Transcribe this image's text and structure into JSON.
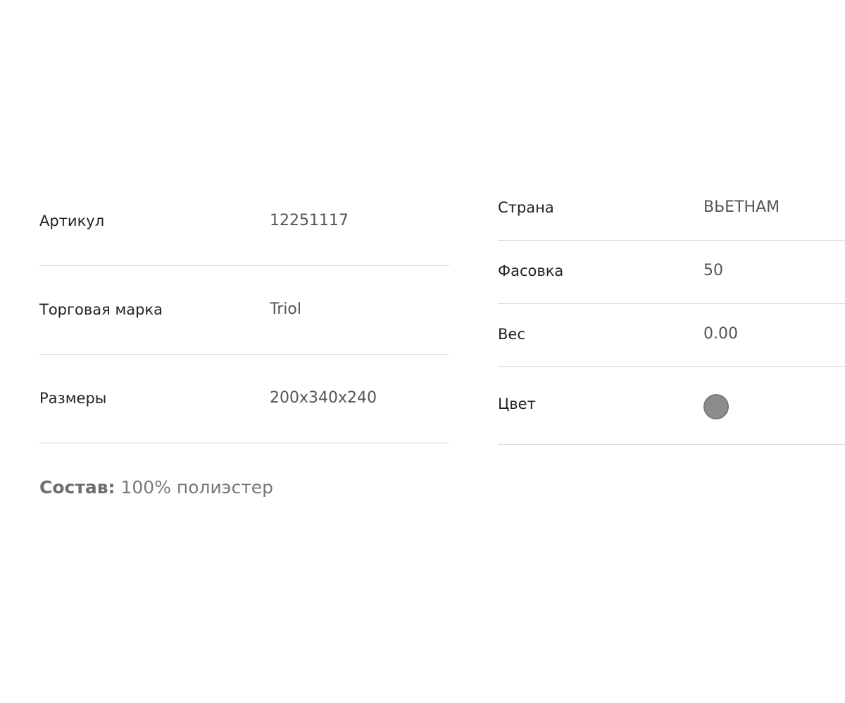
{
  "specs_left": [
    {
      "label": "Артикул",
      "value": "12251117"
    },
    {
      "label": "Торговая марка",
      "value": "Triol"
    },
    {
      "label": "Размеры",
      "value": "200x340x240"
    }
  ],
  "specs_right": {
    "country": {
      "label": "Страна",
      "value": "ВЬЕТНАМ"
    },
    "pack": {
      "label": "Фасовка",
      "value": "50"
    },
    "weight": {
      "label": "Вес",
      "value": "0.00"
    },
    "color": {
      "label": "Цвет",
      "swatch_color": "#8c8c8c"
    }
  },
  "composition": {
    "label": "Состав:",
    "value": " 100% полиэстер"
  }
}
